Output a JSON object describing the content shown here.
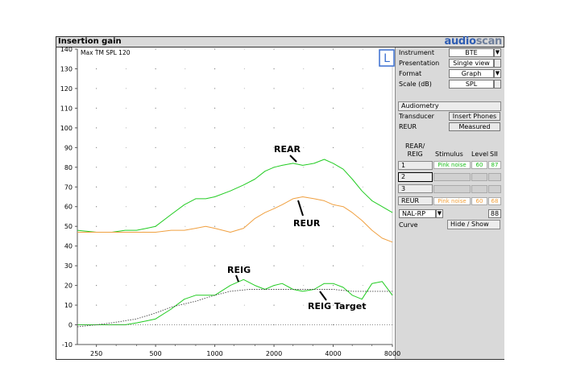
{
  "window": {
    "title": "Insertion gain"
  },
  "brand": {
    "part1": "audio",
    "part2": "scan",
    "color1": "#2f5db3",
    "color2": "#6f7f9b"
  },
  "graph": {
    "ear_badge": "L",
    "max_label": "Max TM SPL 120",
    "y_ticks": [
      "140",
      "130",
      "120",
      "110",
      "100",
      "90",
      "80",
      "70",
      "60",
      "50",
      "40",
      "30",
      "20",
      "10",
      "0",
      "-10"
    ],
    "x_ticks": [
      "250",
      "500",
      "1000",
      "2000",
      "4000",
      "8000"
    ],
    "annotations": {
      "rear": "REAR",
      "reur": "REUR",
      "reig": "REIG",
      "reig_target": "REIG Target"
    },
    "colors": {
      "rear": "#22cc22",
      "reur": "#f0a040",
      "reig": "#22cc22",
      "target": "#444444"
    }
  },
  "chart_data": {
    "type": "line",
    "title": "Insertion gain",
    "xlabel": "",
    "ylabel": "",
    "x_scale": "log",
    "xlim": [
      200,
      8000
    ],
    "ylim": [
      -10,
      140
    ],
    "grid": "dotted",
    "series": [
      {
        "name": "REAR",
        "x": [
          200,
          250,
          300,
          350,
          400,
          450,
          500,
          600,
          700,
          800,
          900,
          1000,
          1200,
          1400,
          1600,
          1800,
          2000,
          2200,
          2500,
          2800,
          3200,
          3600,
          4000,
          4500,
          5000,
          5600,
          6300,
          7100,
          8000
        ],
        "y": [
          48,
          47,
          47,
          48,
          48,
          49,
          50,
          56,
          61,
          64,
          64,
          65,
          68,
          71,
          74,
          78,
          80,
          81,
          82,
          81,
          82,
          84,
          82,
          79,
          74,
          68,
          63,
          60,
          57
        ]
      },
      {
        "name": "REUR",
        "x": [
          200,
          250,
          300,
          400,
          500,
          600,
          700,
          800,
          900,
          1000,
          1200,
          1400,
          1600,
          1800,
          2000,
          2200,
          2500,
          2800,
          3200,
          3600,
          4000,
          4500,
          5000,
          5600,
          6300,
          7100,
          8000
        ],
        "y": [
          47,
          47,
          47,
          47,
          47,
          48,
          48,
          49,
          50,
          49,
          47,
          49,
          54,
          57,
          59,
          61,
          64,
          65,
          64,
          63,
          61,
          60,
          57,
          53,
          48,
          44,
          42
        ]
      },
      {
        "name": "REIG",
        "x": [
          200,
          250,
          300,
          350,
          400,
          450,
          500,
          600,
          700,
          800,
          900,
          1000,
          1200,
          1400,
          1600,
          1800,
          2000,
          2200,
          2500,
          2800,
          3200,
          3600,
          4000,
          4500,
          5000,
          5600,
          6300,
          7100,
          8000
        ],
        "y": [
          0,
          0,
          0,
          0,
          1,
          2,
          3,
          8,
          13,
          15,
          15,
          15,
          20,
          23,
          20,
          18,
          20,
          21,
          18,
          17,
          18,
          21,
          21,
          19,
          15,
          13,
          21,
          22,
          15
        ]
      },
      {
        "name": "REIG Target",
        "x": [
          200,
          250,
          300,
          400,
          500,
          600,
          800,
          1000,
          1200,
          1500,
          2000,
          3000,
          4000,
          5000,
          6000,
          8000
        ],
        "y": [
          -1,
          0,
          1,
          3,
          6,
          9,
          12,
          15,
          17,
          18,
          18,
          18,
          18,
          17,
          17,
          17
        ]
      },
      {
        "name": "0 dB",
        "x": [
          200,
          8000
        ],
        "y": [
          0,
          0
        ]
      }
    ]
  },
  "panel": {
    "instrument": {
      "label": "Instrument",
      "value": "BTE"
    },
    "presentation": {
      "label": "Presentation",
      "value": "Single view"
    },
    "format": {
      "label": "Format",
      "value": "Graph"
    },
    "scale": {
      "label": "Scale (dB)",
      "value": "SPL"
    },
    "audiometry": "Audiometry",
    "transducer": {
      "label": "Transducer",
      "value": "Insert Phones"
    },
    "reur": {
      "label": "REUR",
      "value": "Measured"
    },
    "table": {
      "header_col1": "REAR/\nREIG",
      "header_stimulus": "Stimulus",
      "header_level": "Level",
      "header_sii": "SII",
      "rows": [
        {
          "id": "1",
          "stimulus": "Pink noise",
          "level": "60",
          "sii": "87"
        },
        {
          "id": "2",
          "stimulus": "",
          "level": "",
          "sii": ""
        },
        {
          "id": "3",
          "stimulus": "",
          "level": "",
          "sii": ""
        },
        {
          "id": "REUR",
          "stimulus": "Pink noise",
          "level": "60",
          "sii": "68"
        }
      ]
    },
    "nal": {
      "value": "NAL-RP",
      "number": "88"
    },
    "curve": {
      "label": "Curve",
      "button": "Hide / Show"
    }
  }
}
